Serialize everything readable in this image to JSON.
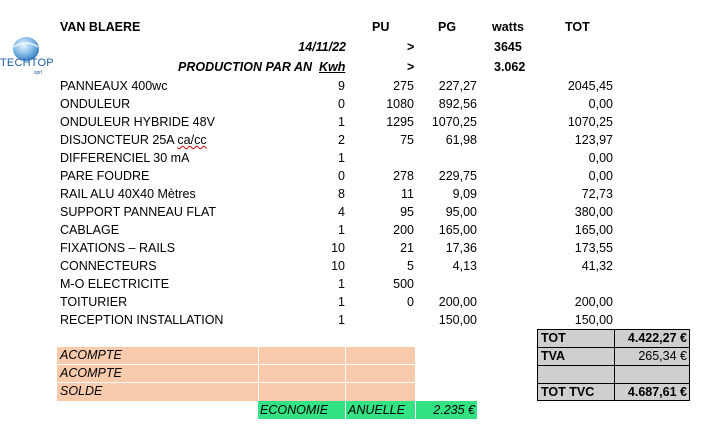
{
  "header": {
    "client": "VAN BLAERE",
    "col_pu": "PU",
    "col_pg": "PG",
    "col_watts": "watts",
    "col_tot": "TOT"
  },
  "logo": {
    "text": "TECHTOP",
    "sub": "sprl"
  },
  "info": [
    {
      "label": "14/11/22",
      "arrow": ">",
      "value": "3645"
    },
    {
      "label_main": "PRODUCTION PAR AN",
      "label_unit": "Kwh",
      "arrow": ">",
      "value": "3.062"
    }
  ],
  "items": [
    {
      "label": "PANNEAUX 400wc",
      "qty": "9",
      "pu": "275",
      "pg": "227,27",
      "tot": "2045,45"
    },
    {
      "label": "ONDULEUR",
      "qty": "0",
      "pu": "1080",
      "pg": "892,56",
      "tot": "0,00"
    },
    {
      "label": "ONDULEUR HYBRIDE 48V",
      "qty": "1",
      "pu": "1295",
      "pg": "1070,25",
      "tot": "1070,25"
    },
    {
      "label_a": "DISJONCTEUR 25A ",
      "label_b": "ca/cc",
      "qty": "2",
      "pu": "75",
      "pg": "61,98",
      "tot": "123,97"
    },
    {
      "label": "DIFFERENCIEL 30 mA",
      "qty": "1",
      "pu": "",
      "pg": "",
      "tot": "0,00"
    },
    {
      "label": "PARE FOUDRE",
      "qty": "0",
      "pu": "278",
      "pg": "229,75",
      "tot": "0,00"
    },
    {
      "label": "RAIL ALU 40X40   Mètres",
      "qty": "8",
      "pu": "11",
      "pg": "9,09",
      "tot": "72,73"
    },
    {
      "label": "SUPPORT PANNEAU FLAT",
      "qty": "4",
      "pu": "95",
      "pg": "95,00",
      "tot": "380,00"
    },
    {
      "label": "CABLAGE",
      "qty": "1",
      "pu": "200",
      "pg": "165,00",
      "tot": "165,00"
    },
    {
      "label": "FIXATIONS – RAILS",
      "qty": "10",
      "pu": "21",
      "pg": "17,36",
      "tot": "173,55"
    },
    {
      "label": "CONNECTEURS",
      "qty": "10",
      "pu": "5",
      "pg": "4,13",
      "tot": "41,32"
    },
    {
      "label": "M-O ELECTRICITE",
      "qty": "1",
      "pu": "500",
      "pg": "",
      "tot": ""
    },
    {
      "label": "TOITURIER",
      "qty": "1",
      "pu": "0",
      "pg": "200,00",
      "tot": "200,00"
    },
    {
      "label": "RECEPTION INSTALLATION",
      "qty": "1",
      "pu": "",
      "pg": "150,00",
      "tot": "150,00"
    }
  ],
  "totals": [
    {
      "label": "TOT",
      "value": "4.422,27 €"
    },
    {
      "label": "TVA",
      "value": "265,34 €"
    },
    {
      "label": "",
      "value": ""
    },
    {
      "label": "TOT TVC",
      "value": "4.687,61 €"
    }
  ],
  "payments": [
    {
      "label": "ACOMPTE"
    },
    {
      "label": "ACOMPTE"
    },
    {
      "label": "SOLDE"
    }
  ],
  "economie": {
    "label_a": "ECONOMIE",
    "label_b": "ANUELLE",
    "value": "2.235 €"
  },
  "colors": {
    "peach": "#f8cbad",
    "grey": "#d0cece",
    "green": "#33e383"
  }
}
